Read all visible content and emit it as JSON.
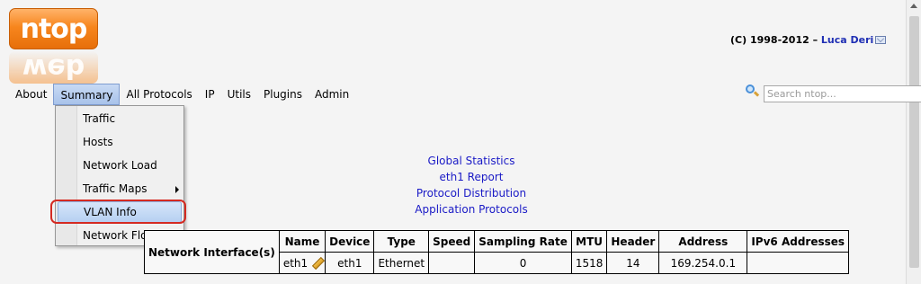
{
  "logo": {
    "text": "ntop",
    "reflection": "web"
  },
  "copyright": {
    "text": "(C) 1998-2012 – ",
    "author": "Luca Deri"
  },
  "menu": {
    "items": [
      "About",
      "Summary",
      "All Protocols",
      "IP",
      "Utils",
      "Plugins",
      "Admin"
    ],
    "active": "Summary"
  },
  "search": {
    "placeholder": "Search ntop..."
  },
  "dropdown": {
    "items": [
      "Traffic",
      "Hosts",
      "Network Load",
      "Traffic Maps",
      "VLAN Info",
      "Network Flows"
    ],
    "highlighted": "VLAN Info",
    "highlight_color": "#d42a22"
  },
  "links": [
    "Global Statistics",
    "eth1 Report",
    "Protocol Distribution",
    "Application Protocols"
  ],
  "table": {
    "row_header": "Network Interface(s)",
    "columns": [
      "Name",
      "Device",
      "Type",
      "Speed",
      "Sampling Rate",
      "MTU",
      "Header",
      "Address",
      "IPv6 Addresses"
    ],
    "rows": [
      [
        "eth1",
        "eth1",
        "Ethernet",
        "",
        "0",
        "1518",
        "14",
        "169.254.0.1",
        ""
      ]
    ]
  },
  "colors": {
    "accent": "#f7861e",
    "link": "#1a1ac6"
  }
}
